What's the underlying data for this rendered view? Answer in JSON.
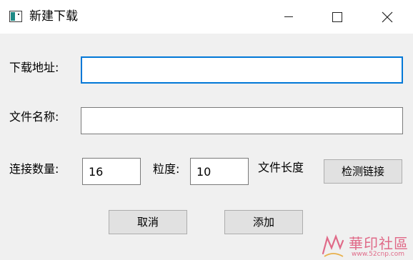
{
  "window": {
    "title": "新建下载",
    "icon": "app-window-icon"
  },
  "form": {
    "url_label": "下载地址:",
    "url_value": "",
    "name_label": "文件名称:",
    "name_value": "",
    "threads_label": "连接数量:",
    "threads_value": "16",
    "granularity_label": "粒度:",
    "granularity_value": "10",
    "file_length_label": "文件长度",
    "check_button": "检测链接"
  },
  "actions": {
    "cancel": "取消",
    "add": "添加"
  },
  "watermark": {
    "text": "華印社區",
    "url": "www.52cnp.com"
  },
  "colors": {
    "focus_border": "#0078d7",
    "button_bg": "#e1e1e1",
    "window_bg": "#f0f0f0"
  }
}
